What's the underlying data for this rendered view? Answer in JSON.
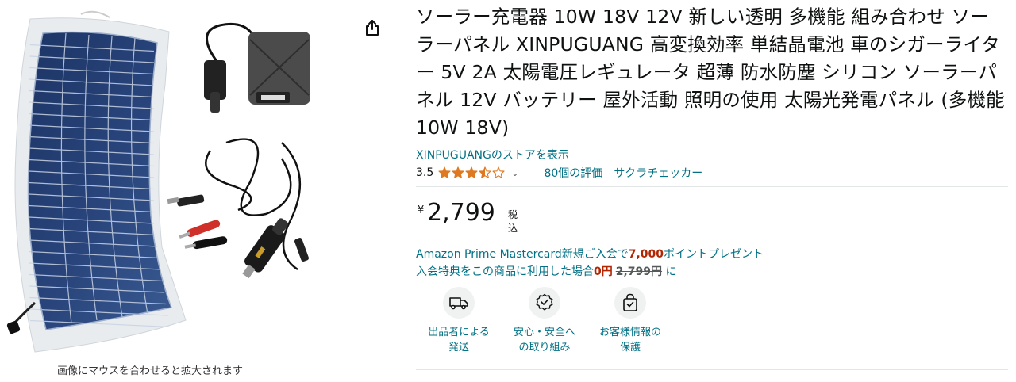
{
  "product": {
    "title": "ソーラー充電器 10W 18V 12V 新しい透明 多機能 組み合わせ ソーラーパネル XINPUGUANG 高変換効率 単結晶電池 車のシガーライター 5V 2A 太陽電圧レギュレータ 超薄 防水防塵 シリコン ソーラーパネル 12V バッテリー 屋外活動 照明の使用 太陽光発電パネル (多機能 10W 18V)",
    "store_link": "XINPUGUANGのストアを表示",
    "image_hint": "画像にマウスを合わせると拡大されます"
  },
  "rating": {
    "value": "3.5",
    "stars": 3.5,
    "max_stars": 5,
    "review_count": "80個の評価",
    "checker": "サクラチェッカー"
  },
  "price": {
    "currency_symbol": "¥",
    "value": "2,799",
    "tax": "税込"
  },
  "promo": {
    "line1_prefix": "Amazon Prime Mastercard新規ご入会で",
    "line1_points": "7,000",
    "line1_suffix": "ポイントプレゼント",
    "line2_prefix": "入会特典をこの商品に利用した場合",
    "line2_price": "0円",
    "line2_strike": "2,799円",
    "line2_suffix": "に"
  },
  "features": [
    {
      "icon": "truck-icon",
      "label": "出品者による\n発送"
    },
    {
      "icon": "shield-badge-icon",
      "label": "安心・安全へ\nの取り組み"
    },
    {
      "icon": "secure-bag-icon",
      "label": "お客様情報の\n保護"
    }
  ],
  "colors": {
    "link": "#007185",
    "star": "#de7921",
    "red": "#b12704",
    "text": "#0f1111"
  }
}
